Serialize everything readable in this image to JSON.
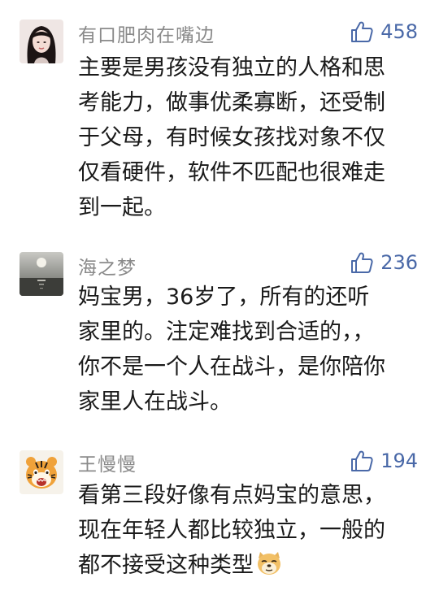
{
  "comments": [
    {
      "username": "有口肥肉在嘴边",
      "likes": "458",
      "avatar": "woman-portrait-icon",
      "lines": [
        "主要是男孩没有独立的人格和思",
        "考能力，做事优柔寡断，还受制",
        "于父母，有时候女孩找对象不仅",
        "仅看硬件，软件不匹配也很难走",
        "到一起。"
      ]
    },
    {
      "username": "海之梦",
      "likes": "236",
      "avatar": "moonlit-sea-icon",
      "lines": [
        "妈宝男，36岁了，所有的还听",
        "家里的。注定难找到合适的，，",
        "你不是一个人在战斗，是你陪你",
        "家里人在战斗。"
      ]
    },
    {
      "username": "王慢慢",
      "likes": "194",
      "avatar": "tiger-cartoon-icon",
      "lines": [
        "看第三段好像有点妈宝的意思，",
        "现在年轻人都比较独立，一般的",
        "都不接受这种类型"
      ],
      "trailing_emoji": "doge-emoji-icon"
    }
  ],
  "colors": {
    "username": "#8a8a8a",
    "like_accent": "#4a69a8",
    "text": "#1a1a1a",
    "background": "#ffffff"
  }
}
